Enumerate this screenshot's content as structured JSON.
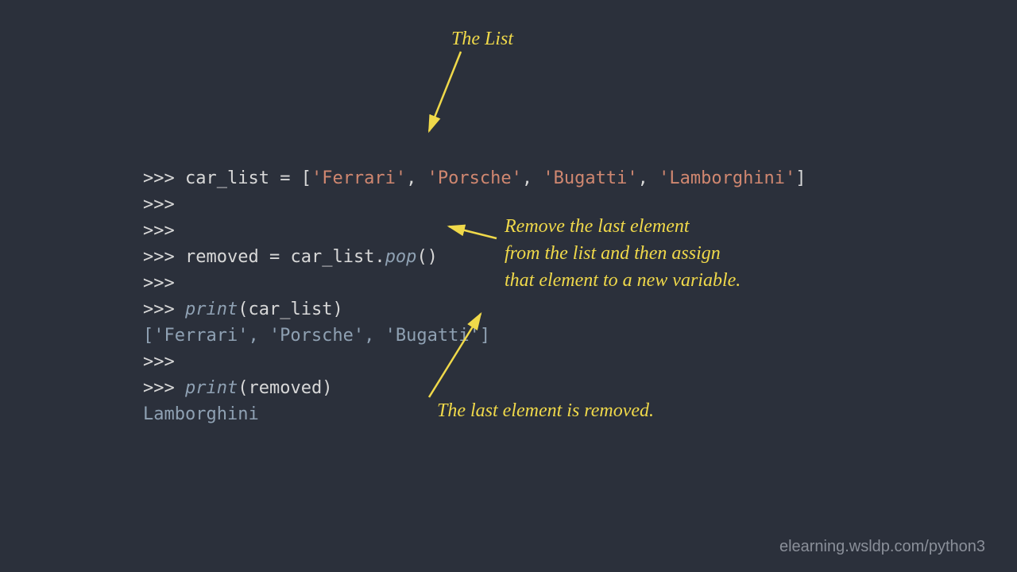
{
  "code": {
    "prompt": ">>>",
    "line1_var": "car_list",
    "line1_eq": " = [",
    "line1_s1": "'Ferrari'",
    "line1_c1": ", ",
    "line1_s2": "'Porsche'",
    "line1_c2": ", ",
    "line1_s3": "'Bugatti'",
    "line1_c3": ", ",
    "line1_s4": "'Lamborghini'",
    "line1_close": "]",
    "line4_var": "removed",
    "line4_eq": " = ",
    "line4_obj": "car_list.",
    "line4_call": "pop",
    "line4_paren": "()",
    "line6_print": "print",
    "line6_arg": "(car_list)",
    "line7_out": "['Ferrari', 'Porsche', 'Bugatti']",
    "line9_print": "print",
    "line9_arg": "(removed)",
    "line10_out": "Lamborghini"
  },
  "annotations": {
    "a1": "The List",
    "a2": "Remove the last element\nfrom the list and then assign\nthat element to a new variable.",
    "a3": "The last element is removed."
  },
  "watermark": "elearning.wsldp.com/python3"
}
